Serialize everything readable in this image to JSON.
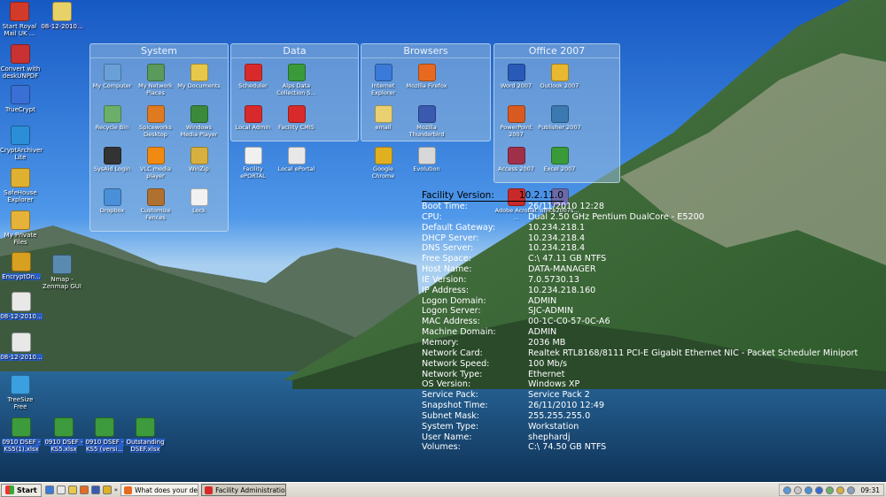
{
  "desktop_icons": [
    {
      "id": "start-royal-mail",
      "label": "Start Royal Mail UK ...",
      "color": "#d23b2a"
    },
    {
      "id": "file-08-12-a",
      "label": "08-12-2010...",
      "color": "#e7d26a"
    },
    {
      "id": "convert-desk",
      "label": "Convert with deskUNPDF",
      "color": "#c83232"
    },
    {
      "id": "truecrypt",
      "label": "TrueCrypt",
      "color": "#3a6fd6"
    },
    {
      "id": "cryptarchiver",
      "label": "CryptArchiver Lite",
      "color": "#2b8fd8"
    },
    {
      "id": "safehouse",
      "label": "SafeHouse Explorer",
      "color": "#e0b030"
    },
    {
      "id": "my-private-files",
      "label": "My Private Files",
      "color": "#e6b23a"
    },
    {
      "id": "encrypton",
      "label": "EncryptOn...",
      "color": "#d8a020"
    },
    {
      "id": "nmap",
      "label": "Nmap - Zenmap GUI",
      "color": "#5a8ab0"
    },
    {
      "id": "file-08-12-b",
      "label": "08-12-2010...",
      "color": "#e8e8e8"
    },
    {
      "id": "file-08-12-c",
      "label": "08-12-2010...",
      "color": "#e8e8e8"
    },
    {
      "id": "treesize",
      "label": "TreeSize Free",
      "color": "#3aa0e0"
    },
    {
      "id": "dsef-1",
      "label": "0910 DSEF - KS5(1).xlsx",
      "color": "#3d9a3d"
    },
    {
      "id": "dsef-2",
      "label": "0910 DSEF - KS5.xlsx",
      "color": "#3d9a3d"
    },
    {
      "id": "dsef-3",
      "label": "0910 DSEF - KS5 (versi...",
      "color": "#3d9a3d"
    },
    {
      "id": "outstanding",
      "label": "Outstanding DSEF.xlsx",
      "color": "#3d9a3d"
    }
  ],
  "fences": [
    {
      "title": "System",
      "items": [
        {
          "label": "My Computer",
          "color": "#6aa0d8"
        },
        {
          "label": "My Network Places",
          "color": "#5a9a5a"
        },
        {
          "label": "My Documents",
          "color": "#e8c84a"
        },
        {
          "label": "Recycle Bin",
          "color": "#6ab06a"
        },
        {
          "label": "Spiceworks Desktop",
          "color": "#e07a20"
        },
        {
          "label": "Windows Media Player",
          "color": "#3b8a3b"
        },
        {
          "label": "SysAid Login",
          "color": "#333333"
        },
        {
          "label": "VLC media player",
          "color": "#f08a10"
        },
        {
          "label": "WinZip",
          "color": "#d8b040"
        },
        {
          "label": "Dropbox",
          "color": "#4a90d8"
        },
        {
          "label": "Customize Fences",
          "color": "#b07030"
        },
        {
          "label": "Lock",
          "color": "#f2f2f2"
        }
      ]
    },
    {
      "title": "Data",
      "items": [
        {
          "label": "Scheduler",
          "color": "#d82a2a"
        },
        {
          "label": "Alps Data Collection S...",
          "color": "#3a9a3a"
        },
        {
          "label": "Local Admin",
          "color": "#d82a2a"
        },
        {
          "label": "Facility CMIS",
          "color": "#d82a2a"
        },
        {
          "label": "Facility ePORTAL",
          "color": "#f0f0f0"
        },
        {
          "label": "Local ePortal",
          "color": "#e8e8e8"
        }
      ]
    },
    {
      "title": "Browsers",
      "items": [
        {
          "label": "Internet Explorer",
          "color": "#3a7ad8"
        },
        {
          "label": "Mozilla Firefox",
          "color": "#e86a20"
        },
        {
          "label": "email",
          "color": "#e8d070"
        },
        {
          "label": "Mozilla Thunderbird",
          "color": "#3a5ab0"
        },
        {
          "label": "Google Chrome",
          "color": "#e0b020"
        },
        {
          "label": "Evolution",
          "color": "#d8d8d8"
        }
      ]
    },
    {
      "title": "Office 2007",
      "items": [
        {
          "label": "Word 2007",
          "color": "#2a5ab8"
        },
        {
          "label": "Outlook 2007",
          "color": "#e8b830"
        },
        {
          "label": "PowerPoint 2007",
          "color": "#d85a20"
        },
        {
          "label": "Publisher 2007",
          "color": "#3a7ab0"
        },
        {
          "label": "Access 2007",
          "color": "#a0304a"
        },
        {
          "label": "Excel 2007",
          "color": "#3a9a3a"
        },
        {
          "label": "Adobe Acrobat ...",
          "color": "#c82a2a"
        },
        {
          "label": "office2007s...",
          "color": "#6a6aa8"
        }
      ]
    }
  ],
  "bginfo": [
    {
      "key": "Facility Version:",
      "value": "10.2.11.0"
    },
    {
      "key": "Boot Time:",
      "value": "26/11/2010 12:28"
    },
    {
      "key": "CPU:",
      "value": "Dual 2.50 GHz Pentium DualCore - E5200"
    },
    {
      "key": "Default Gateway:",
      "value": "10.234.218.1"
    },
    {
      "key": "DHCP Server:",
      "value": "10.234.218.4"
    },
    {
      "key": "DNS Server:",
      "value": "10.234.218.4"
    },
    {
      "key": "Free Space:",
      "value": "C:\\ 47.11 GB NTFS"
    },
    {
      "key": "Host Name:",
      "value": "DATA-MANAGER"
    },
    {
      "key": "IE Version:",
      "value": "7.0.5730.13"
    },
    {
      "key": "IP Address:",
      "value": "10.234.218.160"
    },
    {
      "key": "Logon Domain:",
      "value": "ADMIN"
    },
    {
      "key": "Logon Server:",
      "value": "SJC-ADMIN"
    },
    {
      "key": "MAC Address:",
      "value": "00-1C-C0-57-0C-A6"
    },
    {
      "key": "Machine Domain:",
      "value": "ADMIN"
    },
    {
      "key": "Memory:",
      "value": "2036 MB"
    },
    {
      "key": "Network Card:",
      "value": "Realtek RTL8168/8111 PCI-E Gigabit Ethernet NIC - Packet Scheduler Miniport"
    },
    {
      "key": "Network Speed:",
      "value": "100 Mb/s"
    },
    {
      "key": "Network Type:",
      "value": "Ethernet"
    },
    {
      "key": "OS Version:",
      "value": "Windows XP"
    },
    {
      "key": "Service Pack:",
      "value": "Service Pack 2"
    },
    {
      "key": "Snapshot Time:",
      "value": "26/11/2010 12:49"
    },
    {
      "key": "Subnet Mask:",
      "value": "255.255.255.0"
    },
    {
      "key": "System Type:",
      "value": "Workstation"
    },
    {
      "key": "User Name:",
      "value": "shephardj"
    },
    {
      "key": "Volumes:",
      "value": "C:\\ 74.50 GB NTFS"
    }
  ],
  "taskbar": {
    "start_label": "Start",
    "tasks": [
      {
        "label": "What does your desktop...",
        "color": "#e86a20",
        "active": false
      },
      {
        "label": "Facility Administration - [...",
        "color": "#d82a2a",
        "active": true
      }
    ],
    "help_label": "?",
    "chevron": "«",
    "clock": "09:31"
  },
  "colors": {
    "accent": "#2a5fc6"
  }
}
